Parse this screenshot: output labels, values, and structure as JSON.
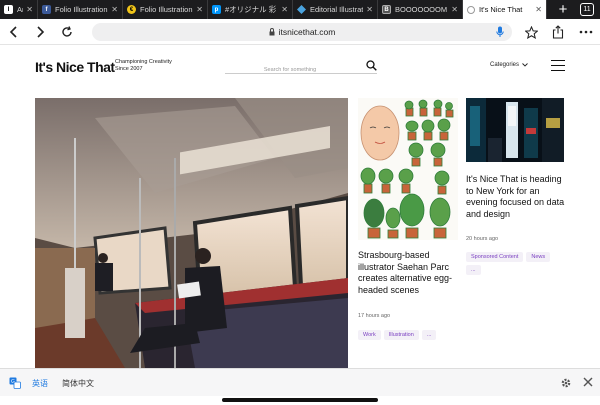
{
  "tabs": [
    {
      "label": "Ar",
      "icon": "it-favicon-icon",
      "active": false
    },
    {
      "label": "Folio Illustration",
      "icon": "facebook-icon",
      "active": false
    },
    {
      "label": "Folio Illustration",
      "icon": "folio-icon",
      "active": false
    },
    {
      "label": "#オリジナル 彩",
      "icon": "pixiv-icon",
      "active": false
    },
    {
      "label": "Editorial Illustrat",
      "icon": "editorial-icon",
      "active": false
    },
    {
      "label": "BOOOOOOOM",
      "icon": "booooooom-icon",
      "active": false
    },
    {
      "label": "It's Nice That",
      "icon": "itsnicethat-icon",
      "active": true
    }
  ],
  "tab_count": "11",
  "address": {
    "url": "itsnicethat.com"
  },
  "site": {
    "logo": "It's Nice That",
    "tagline_line1": "Championing Creativity",
    "tagline_line2": "Since 2007",
    "search_placeholder": "Search for something",
    "categories_label": "Categories"
  },
  "articles": [
    {
      "title": "Strasbourg-based illustrator Saehan Parc creates alternative egg-headed scenes",
      "time": "17 hours ago",
      "tags": [
        "Work",
        "Illustration",
        "..."
      ]
    },
    {
      "title": "It's Nice That is heading to New York for an evening focused on data and design",
      "time": "20 hours ago",
      "tags": [
        "Sponsored Content",
        "News",
        "..."
      ]
    }
  ],
  "translate": {
    "lang_a": "英语",
    "lang_b": "简体中文"
  },
  "colors": {
    "accent": "#1f7ae0",
    "tag_text": "#7a3fc1",
    "tab_bar": "#1c1c1e"
  }
}
